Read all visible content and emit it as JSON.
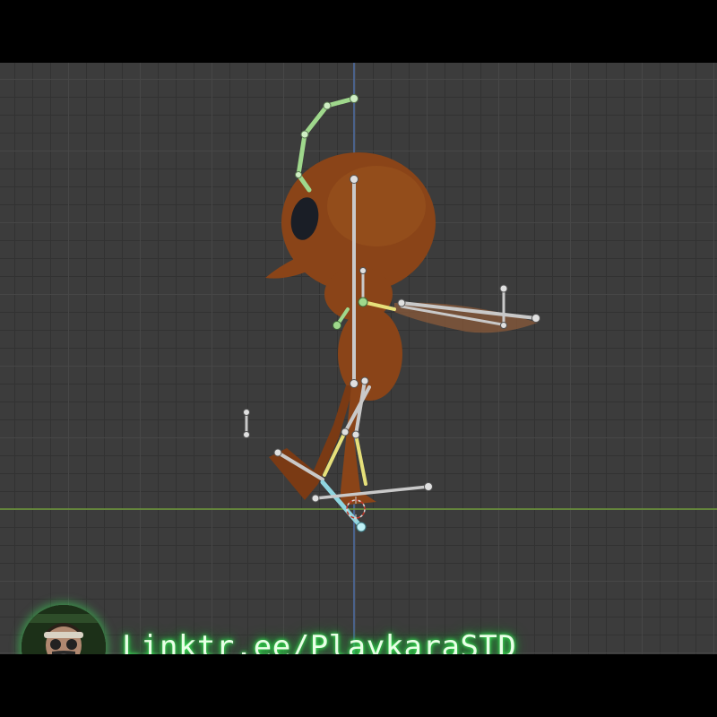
{
  "overlay": {
    "link_text": "Linktr.ee/PlaykaraSTD"
  },
  "colors": {
    "viewport_background": "#3c3c3c",
    "grid_major": "#474747",
    "grid_minor": "#323232",
    "x_axis_line": "#6f9a3a",
    "z_axis_line": "#4f6fa6",
    "character_body": "#8a4418",
    "bone_default": "#c9c9c9",
    "bone_selected": "#9fd88c",
    "bone_yellow": "#e6e07a",
    "bone_active": "#8fd6e0",
    "link_glow": "#3cff5a"
  },
  "icons": {
    "avatar": "person-gasmask-avatar-icon",
    "origin": "origin-marker-icon"
  }
}
